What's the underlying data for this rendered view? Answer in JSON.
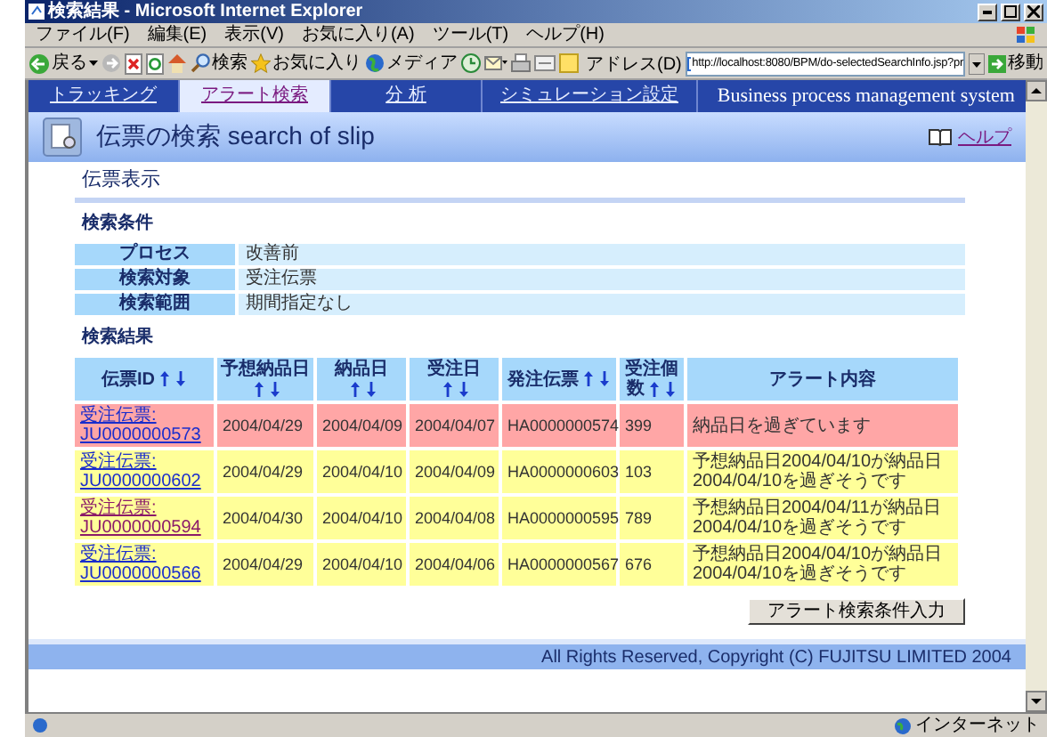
{
  "window": {
    "title": "検索結果 - Microsoft Internet Explorer"
  },
  "menu": [
    "ファイル(F)",
    "編集(E)",
    "表示(V)",
    "お気に入り(A)",
    "ツール(T)",
    "ヘルプ(H)"
  ],
  "toolbar": {
    "back": "戻る",
    "search": "検索",
    "favorites": "お気に入り",
    "media": "メディア",
    "address_label": "アドレス(D)",
    "url": "http://localhost:8080/BPM/do-selectedSearchInfo.jsp?pr",
    "go": "移動"
  },
  "nav": {
    "tabs": [
      {
        "label": "トラッキング",
        "selected": false
      },
      {
        "label": "アラート検索",
        "selected": true
      },
      {
        "label": "分 析",
        "selected": false
      },
      {
        "label": "シミュレーション設定",
        "selected": false
      }
    ],
    "system_name": "Business process management system"
  },
  "header": {
    "title": "伝票の検索",
    "subtitle": "search of slip",
    "help": "ヘルプ"
  },
  "section_title": "伝票表示",
  "conditions": {
    "title": "検索条件",
    "rows": [
      {
        "label": "プロセス",
        "value": "改善前"
      },
      {
        "label": "検索対象",
        "value": "受注伝票"
      },
      {
        "label": "検索範囲",
        "value": "期間指定なし"
      }
    ]
  },
  "results": {
    "title": "検索結果",
    "columns": [
      {
        "label": "伝票ID",
        "sortable": true
      },
      {
        "label": "予想納品日",
        "sortable": true
      },
      {
        "label": "納品日",
        "sortable": true
      },
      {
        "label": "受注日",
        "sortable": true
      },
      {
        "label": "発注伝票",
        "sortable": true
      },
      {
        "label": "受注個数",
        "sortable": true
      },
      {
        "label": "アラート内容",
        "sortable": false
      }
    ],
    "rows": [
      {
        "visited": false,
        "color": "#ffa6a6",
        "cells": [
          "受注伝票:\nJU0000000573",
          "2004/04/29",
          "2004/04/09",
          "2004/04/07",
          "HA0000000574",
          "399",
          "納品日を過ぎています"
        ]
      },
      {
        "visited": false,
        "color": "#ffff99",
        "cells": [
          "受注伝票:\nJU0000000602",
          "2004/04/29",
          "2004/04/10",
          "2004/04/09",
          "HA0000000603",
          "103",
          "予想納品日2004/04/10が納品日 2004/04/10を過ぎそうです"
        ]
      },
      {
        "visited": true,
        "color": "#ffff99",
        "cells": [
          "受注伝票:\nJU0000000594",
          "2004/04/30",
          "2004/04/10",
          "2004/04/08",
          "HA0000000595",
          "789",
          "予想納品日2004/04/11が納品日 2004/04/10を過ぎそうです"
        ]
      },
      {
        "visited": false,
        "color": "#ffff99",
        "cells": [
          "受注伝票:\nJU0000000566",
          "2004/04/29",
          "2004/04/10",
          "2004/04/06",
          "HA0000000567",
          "676",
          "予想納品日2004/04/10が納品日 2004/04/10を過ぎそうです"
        ]
      }
    ]
  },
  "button": "アラート検索条件入力",
  "footer": "All Rights Reserved, Copyright (C) FUJITSU LIMITED 2004",
  "status_bar": {
    "zone": "インターネット"
  }
}
